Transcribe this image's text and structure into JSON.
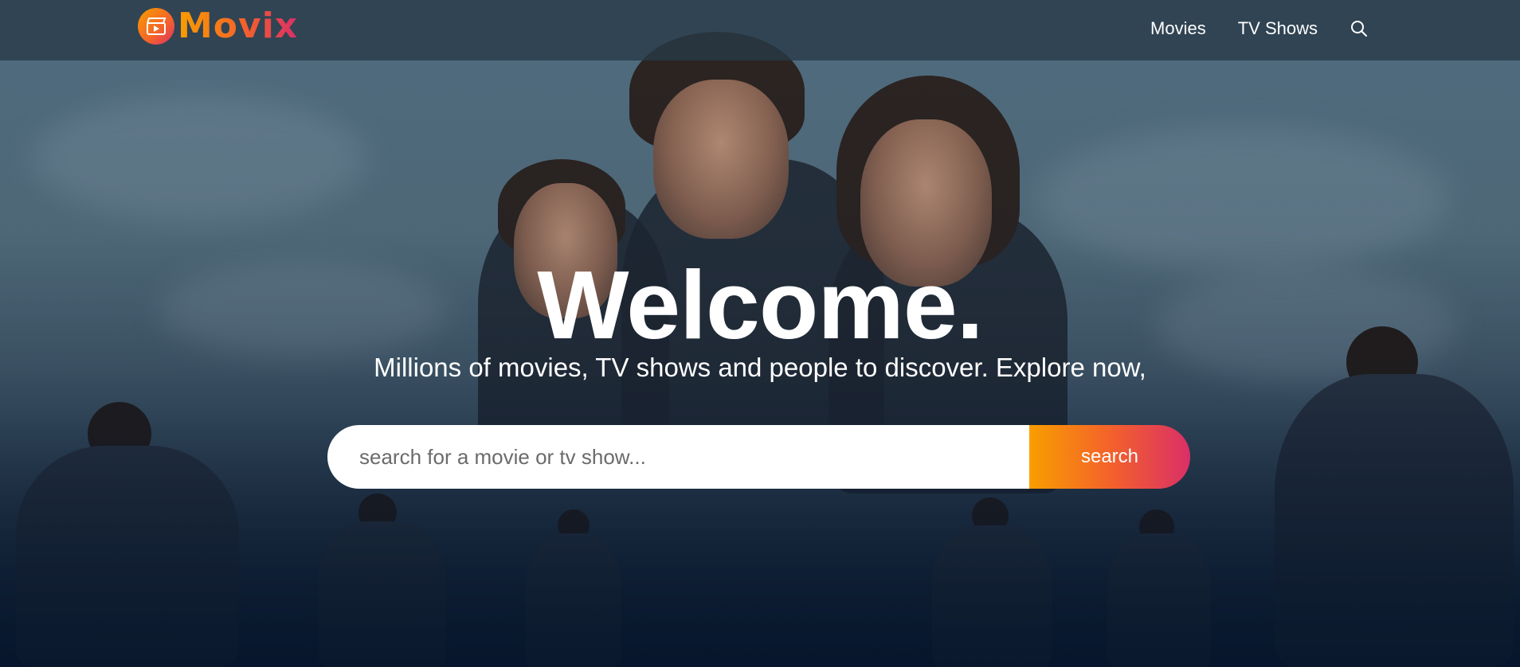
{
  "app": {
    "brand": "Movix",
    "logo_icon": "clapperboard-play-icon"
  },
  "header": {
    "nav": [
      {
        "label": "Movies"
      },
      {
        "label": "TV Shows"
      }
    ],
    "search_icon": "search-icon"
  },
  "hero": {
    "title": "Welcome.",
    "subtitle": "Millions of movies, TV shows and people to discover. Explore now,",
    "search": {
      "placeholder": "search for a movie or tv show...",
      "value": "",
      "button_label": "search"
    }
  },
  "colors": {
    "gradient_start": "#f89e00",
    "gradient_end": "#da2f68",
    "header_bg": "#283a48",
    "hero_dark": "#04152d"
  }
}
